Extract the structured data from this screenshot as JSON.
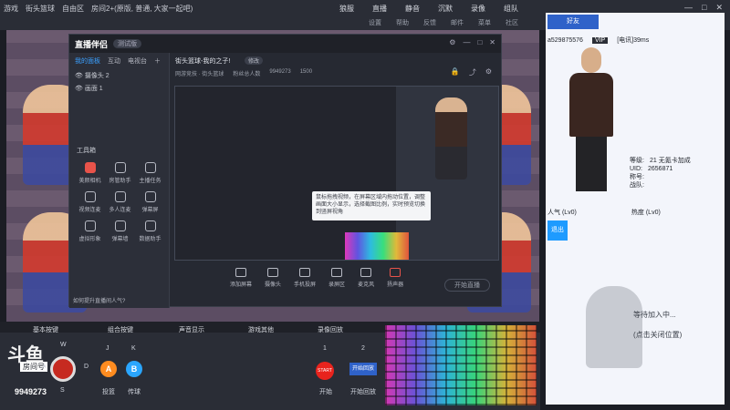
{
  "topbar": {
    "crumbs": [
      "游戏",
      "街头篮球",
      "自由区",
      "房间2+(原版, 普通, 大家一起吧)"
    ],
    "tabs": [
      "狼服",
      "直播",
      "静音",
      "沉默",
      "录像",
      "组队"
    ],
    "subtabs": [
      "设置",
      "帮助",
      "反馈",
      "邮件",
      "菜单",
      "社区"
    ],
    "controls": [
      "—",
      "□",
      "✕"
    ]
  },
  "app": {
    "logo": "直播伴侣",
    "version": "测试版",
    "left_tabs": [
      "我的面板",
      "互动",
      "电视台"
    ],
    "scenes": [
      "摄像头 2",
      "画面 1"
    ],
    "tools_title": "工具箱",
    "tools": [
      {
        "label": "美颜相机",
        "red": true
      },
      {
        "label": "房管助手",
        "red": false
      },
      {
        "label": "主播任务",
        "red": false
      },
      {
        "label": "视频连麦",
        "red": false
      },
      {
        "label": "多人连麦",
        "red": false
      },
      {
        "label": "弹幕屏",
        "red": false
      },
      {
        "label": "虚拟形象",
        "red": false
      },
      {
        "label": "弹幕墙",
        "red": false
      },
      {
        "label": "数据助手",
        "red": false
      }
    ],
    "notice": "如何提升直播间人气?",
    "room_title": "街头篮球-我的之子!",
    "room_tag": "修改",
    "room_meta": [
      "网游竞技 · 街头篮球",
      "粉丝总人数",
      "9949273",
      "1500"
    ],
    "tooltip": "鼠标拖拽视频，在屏幕区域内拖动位置，调整画面大小显示，选择截图比例，实时预览切换到竖屏视角",
    "bottom_items": [
      {
        "label": "添加屏幕",
        "red": false
      },
      {
        "label": "摄像头",
        "red": false
      },
      {
        "label": "手机投屏",
        "red": false
      },
      {
        "label": "录屏区",
        "red": false
      },
      {
        "label": "麦克风",
        "red": false
      },
      {
        "label": "扬声器",
        "red": true
      }
    ],
    "start_label": "开始直播"
  },
  "sidebar": {
    "tab": "好友",
    "user_id": "a529875576",
    "tag": "VIP",
    "status": "[电讯]39ms",
    "stats": [
      {
        "k": "等级:",
        "v": "21"
      },
      {
        "k": "UID:",
        "v": "2656871"
      },
      {
        "k": "称号:",
        "v": ""
      },
      {
        "k": "战队:",
        "v": ""
      }
    ],
    "extra": "无氪卡加成",
    "mood_left": "人气 (Lv0)",
    "mood_right": "热度 (Lv0)",
    "mini_label": "退出",
    "wait": "等待加入中...",
    "wait_sub": "(点击关闭位置)"
  },
  "legend": {
    "headers": [
      "基本按键",
      "组合按键",
      "声音显示",
      "游戏其他",
      "录像回放"
    ],
    "keys": [
      "W",
      "A",
      "S",
      "D",
      "J",
      "K",
      "1",
      "2"
    ],
    "combo": [
      "投篮",
      "传球"
    ],
    "record": [
      "开始",
      "开始回放"
    ],
    "start_btn": "START",
    "douyu": "斗鱼",
    "room_label": "房间号",
    "room_no": "9949273"
  }
}
